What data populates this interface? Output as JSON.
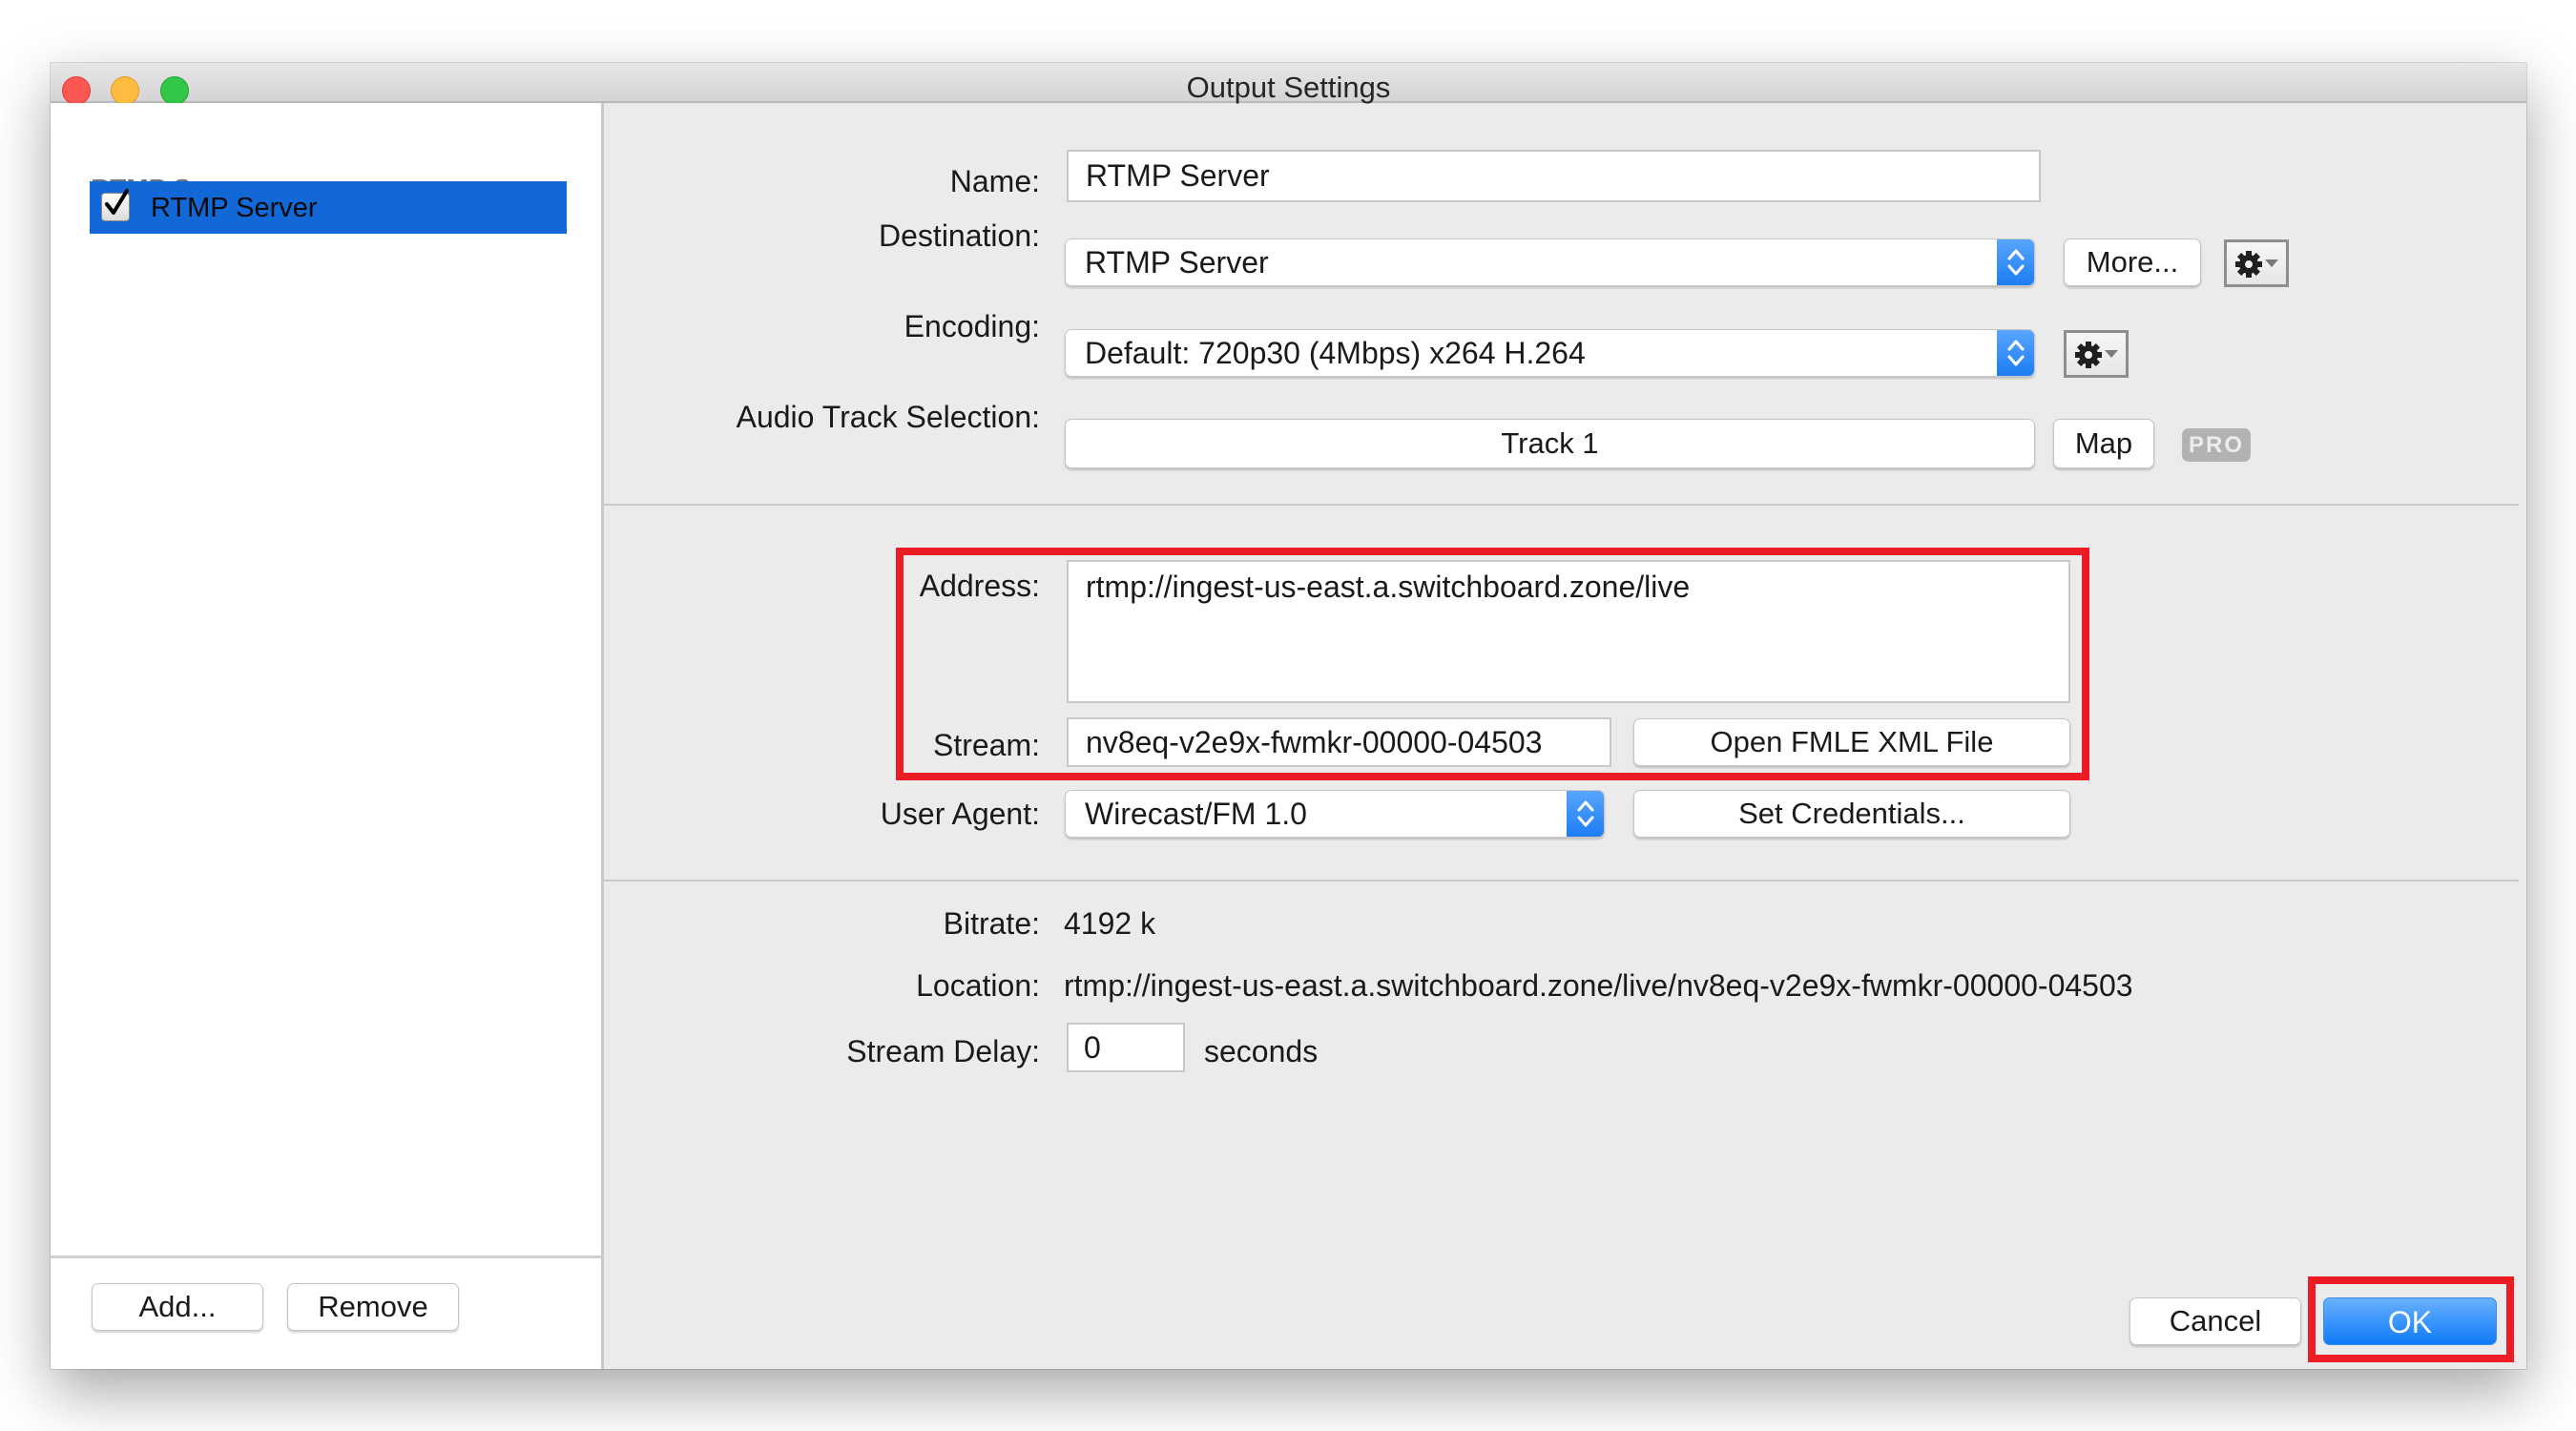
{
  "window": {
    "title": "Output Settings"
  },
  "sidebar": {
    "section_header": "RTMP Server",
    "items": [
      {
        "label": "RTMP Server",
        "checked": true,
        "selected": true
      }
    ],
    "add_button": "Add...",
    "remove_button": "Remove"
  },
  "form": {
    "name_label": "Name:",
    "name_value": "RTMP Server",
    "destination_label": "Destination:",
    "destination_value": "RTMP Server",
    "more_button": "More...",
    "encoding_label": "Encoding:",
    "encoding_value": "Default: 720p30 (4Mbps) x264 H.264",
    "audio_label": "Audio Track Selection:",
    "audio_value": "Track 1",
    "map_button": "Map",
    "pro_badge": "PRO",
    "address_label": "Address:",
    "address_value": "rtmp://ingest-us-east.a.switchboard.zone/live",
    "stream_label": "Stream:",
    "stream_value": "nv8eq-v2e9x-fwmkr-00000-04503",
    "open_fmle_button": "Open FMLE XML File",
    "user_agent_label": "User Agent:",
    "user_agent_value": "Wirecast/FM 1.0",
    "set_credentials_button": "Set Credentials...",
    "bitrate_label": "Bitrate:",
    "bitrate_value": "4192 k",
    "location_label": "Location:",
    "location_value": "rtmp://ingest-us-east.a.switchboard.zone/live/nv8eq-v2e9x-fwmkr-00000-04503",
    "stream_delay_label": "Stream Delay:",
    "stream_delay_value": "0",
    "stream_delay_unit": "seconds"
  },
  "footer": {
    "cancel_button": "Cancel",
    "ok_button": "OK"
  },
  "colors": {
    "selection": "#1268d6",
    "accent": "#1b7cf2",
    "highlight": "#ec1c24"
  }
}
